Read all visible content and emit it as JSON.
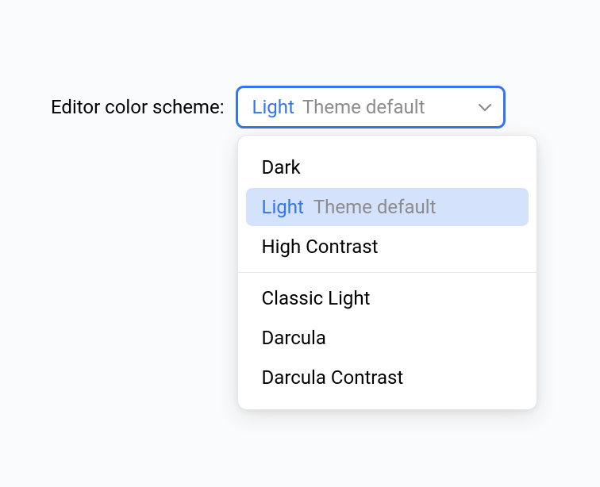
{
  "setting": {
    "label": "Editor color scheme:",
    "selected": {
      "name": "Light",
      "hint": "Theme default"
    }
  },
  "menu": {
    "group1": [
      {
        "name": "Dark",
        "hint": ""
      },
      {
        "name": "Light",
        "hint": "Theme default"
      },
      {
        "name": "High Contrast",
        "hint": ""
      }
    ],
    "group2": [
      {
        "name": "Classic Light",
        "hint": ""
      },
      {
        "name": "Darcula",
        "hint": ""
      },
      {
        "name": "Darcula Contrast",
        "hint": ""
      }
    ]
  },
  "icons": {
    "chevron": "chevron-down"
  }
}
